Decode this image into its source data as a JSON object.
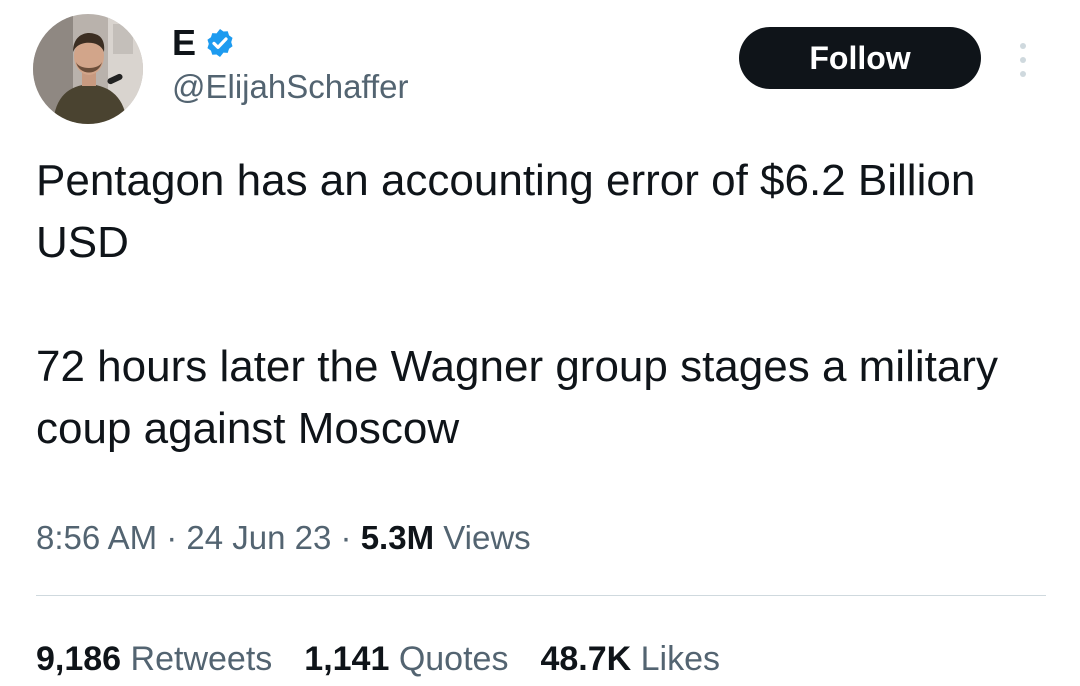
{
  "author": {
    "display_name": "E",
    "handle": "@ElijahSchaffer",
    "verified": true
  },
  "follow_label": "Follow",
  "text": {
    "paragraph_1": "Pentagon has an accounting error of $6.2 Billion USD",
    "paragraph_2": "72 hours later the Wagner group stages a military coup against Moscow"
  },
  "meta": {
    "time": "8:56 AM",
    "separator_1": " · ",
    "date": "24 Jun 23",
    "separator_2": " · ",
    "views_count": "5.3M",
    "views_label": " Views"
  },
  "stats": {
    "retweets_count": "9,186",
    "retweets_label": "Retweets",
    "quotes_count": "1,141",
    "quotes_label": "Quotes",
    "likes_count": "48.7K",
    "likes_label": "Likes"
  },
  "colors": {
    "text_primary": "#0f1419",
    "text_secondary": "#536471",
    "verified_blue": "#1d9bf0",
    "follow_bg": "#0f1419"
  },
  "icons": {
    "verified": "verified-badge-icon",
    "more": "more-options-icon"
  }
}
